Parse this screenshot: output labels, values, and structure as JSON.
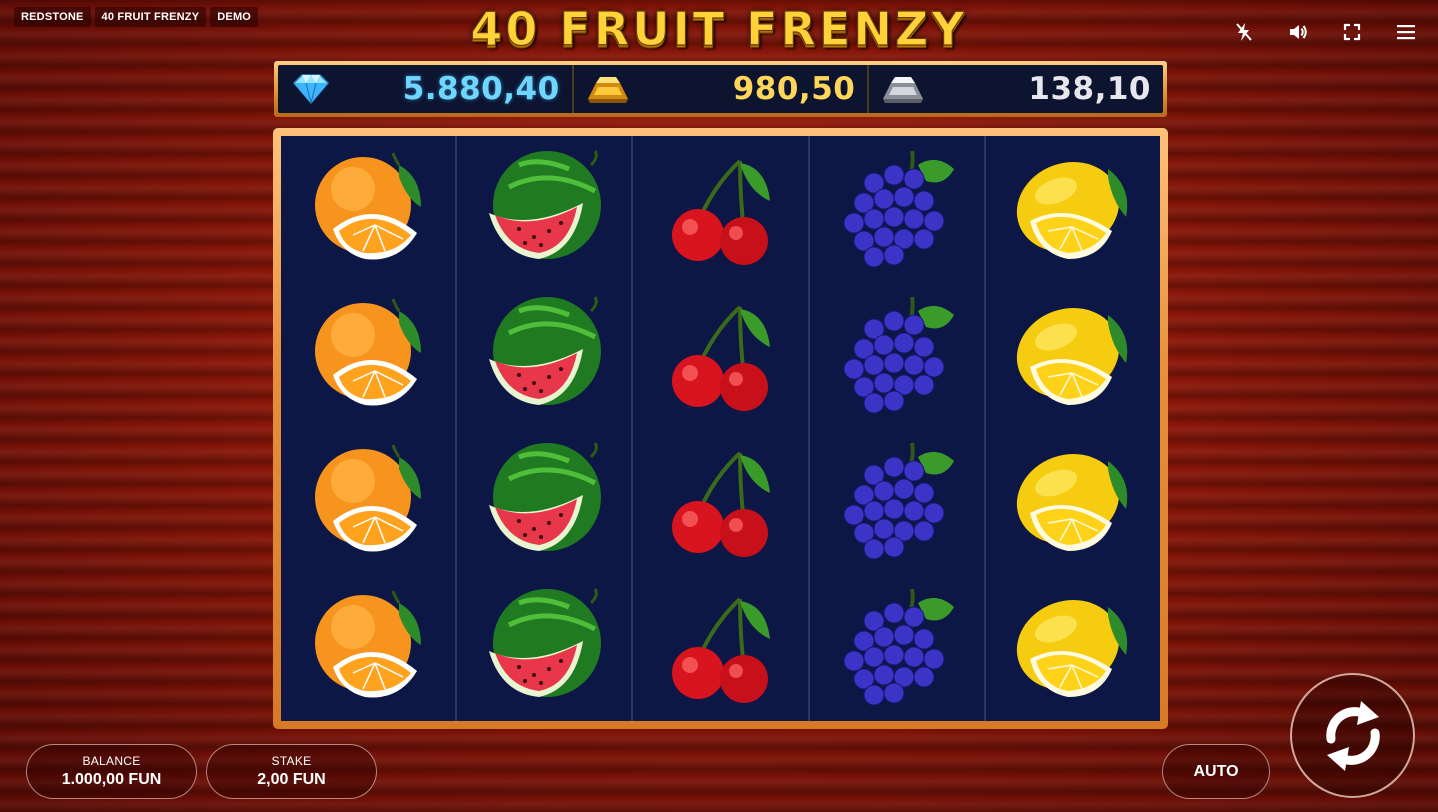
{
  "header": {
    "tags": [
      "REDSTONE",
      "40 FRUIT FRENZY",
      "DEMO"
    ],
    "logo": "40 FRUIT FRENZY",
    "controls": [
      "turbo-off-icon",
      "sound-icon",
      "fullscreen-icon",
      "menu-icon"
    ]
  },
  "jackpots": [
    {
      "icon": "diamond-icon",
      "value": "5.880,40"
    },
    {
      "icon": "gold-bar-icon",
      "value": "980,50"
    },
    {
      "icon": "silver-bar-icon",
      "value": "138,10"
    }
  ],
  "reels": [
    {
      "symbol": "orange",
      "rows": 4
    },
    {
      "symbol": "watermelon",
      "rows": 4
    },
    {
      "symbol": "cherry",
      "rows": 4
    },
    {
      "symbol": "grapes",
      "rows": 4
    },
    {
      "symbol": "lemon",
      "rows": 4
    }
  ],
  "footer": {
    "balance_label": "BALANCE",
    "balance_value": "1.000,00 FUN",
    "stake_label": "STAKE",
    "stake_value": "2,00 FUN",
    "auto_label": "AUTO",
    "spin": "spin-icon"
  },
  "colors": {
    "background": "#8a1608",
    "frame": "#e88f3a",
    "reel_bg": "#0c1745",
    "logo": "#ffd23a",
    "diamond_value": "#6fd6ff",
    "gold_value": "#ffd65a",
    "silver_value": "#e6e6ec"
  }
}
